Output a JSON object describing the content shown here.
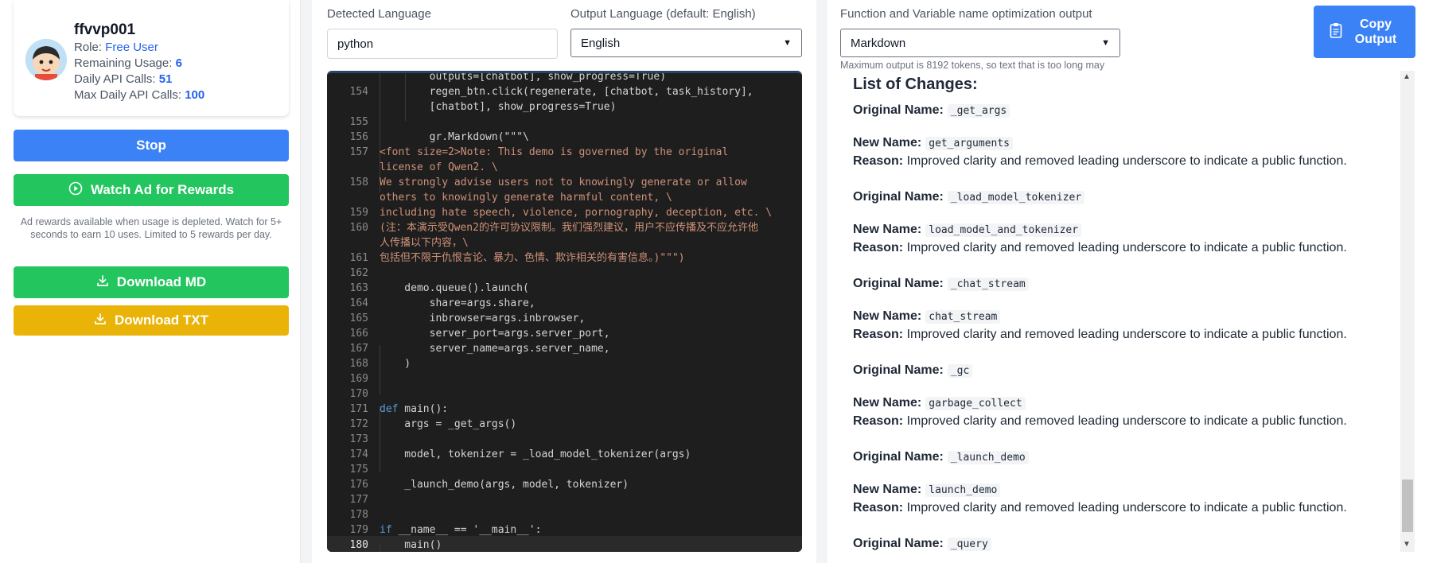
{
  "user": {
    "username": "ffvvp001",
    "role_label": "Role:",
    "role_value": "Free User",
    "remaining_label": "Remaining Usage:",
    "remaining_value": "6",
    "daily_label": "Daily API Calls:",
    "daily_value": "51",
    "max_label": "Max Daily API Calls:",
    "max_value": "100"
  },
  "left": {
    "stop_label": "Stop",
    "watch_ad_label": "Watch Ad for Rewards",
    "ad_note": "Ad rewards available when usage is depleted. Watch for 5+ seconds to earn 10 uses. Limited to 5 rewards per day.",
    "download_md_label": "Download MD",
    "download_txt_label": "Download TXT"
  },
  "middle": {
    "detected_label": "Detected Language",
    "detected_value": "python",
    "output_lang_label": "Output Language (default: English)",
    "output_lang_value": "English"
  },
  "editor": {
    "lines": [
      {
        "n": "",
        "t": "        outputs=[chatbot], show_progress=True)"
      },
      {
        "n": "154",
        "t": "        regen_btn.click(regenerate, [chatbot, task_history],"
      },
      {
        "n": "",
        "t": "        [chatbot], show_progress=True)"
      },
      {
        "n": "155",
        "t": ""
      },
      {
        "n": "156",
        "t": "        gr.Markdown(\"\"\"\\"
      },
      {
        "n": "157",
        "t": "<font size=2>Note: This demo is governed by the original"
      },
      {
        "n": "",
        "t": "license of Qwen2. \\"
      },
      {
        "n": "158",
        "t": "We strongly advise users not to knowingly generate or allow"
      },
      {
        "n": "",
        "t": "others to knowingly generate harmful content, \\"
      },
      {
        "n": "159",
        "t": "including hate speech, violence, pornography, deception, etc. \\"
      },
      {
        "n": "160",
        "t": "(注：本演示受Qwen2的许可协议限制。我们强烈建议，用户不应传播及不应允许他"
      },
      {
        "n": "",
        "t": "人传播以下内容，\\"
      },
      {
        "n": "161",
        "t": "包括但不限于仇恨言论、暴力、色情、欺诈相关的有害信息。)\"\"\")"
      },
      {
        "n": "162",
        "t": ""
      },
      {
        "n": "163",
        "t": "    demo.queue().launch("
      },
      {
        "n": "164",
        "t": "        share=args.share,"
      },
      {
        "n": "165",
        "t": "        inbrowser=args.inbrowser,"
      },
      {
        "n": "166",
        "t": "        server_port=args.server_port,"
      },
      {
        "n": "167",
        "t": "        server_name=args.server_name,"
      },
      {
        "n": "168",
        "t": "    )"
      },
      {
        "n": "169",
        "t": ""
      },
      {
        "n": "170",
        "t": ""
      },
      {
        "n": "171",
        "t": "def main():"
      },
      {
        "n": "172",
        "t": "    args = _get_args()"
      },
      {
        "n": "173",
        "t": ""
      },
      {
        "n": "174",
        "t": "    model, tokenizer = _load_model_tokenizer(args)"
      },
      {
        "n": "175",
        "t": ""
      },
      {
        "n": "176",
        "t": "    _launch_demo(args, model, tokenizer)"
      },
      {
        "n": "177",
        "t": ""
      },
      {
        "n": "178",
        "t": ""
      },
      {
        "n": "179",
        "t": "if __name__ == '__main__':"
      },
      {
        "n": "180",
        "t": "    main()"
      }
    ],
    "active_line": "180"
  },
  "right": {
    "func_label": "Function and Variable name optimization output",
    "format_value": "Markdown",
    "copy_label": "Copy Output",
    "hint": "Maximum output is 8192 tokens, so text that is too long may",
    "output_title": "List of Changes:",
    "original_label": "Original Name:",
    "new_label": "New Name:",
    "reason_label": "Reason:",
    "changes": [
      {
        "original": "_get_args",
        "new": "get_arguments",
        "reason": "Improved clarity and removed leading underscore to indicate a public function."
      },
      {
        "original": "_load_model_tokenizer",
        "new": "load_model_and_tokenizer",
        "reason": "Improved clarity and removed leading underscore to indicate a public function."
      },
      {
        "original": "_chat_stream",
        "new": "chat_stream",
        "reason": "Improved clarity and removed leading underscore to indicate a public function."
      },
      {
        "original": "_gc",
        "new": "garbage_collect",
        "reason": "Improved clarity and removed leading underscore to indicate a public function."
      },
      {
        "original": "_launch_demo",
        "new": "launch_demo",
        "reason": "Improved clarity and removed leading underscore to indicate a public function."
      },
      {
        "original": "_query",
        "new": "",
        "reason": ""
      }
    ]
  },
  "colors": {
    "primary": "#3b82f6",
    "success": "#22c55e",
    "warning": "#eab308",
    "editor_bg": "#1e1e1e"
  }
}
